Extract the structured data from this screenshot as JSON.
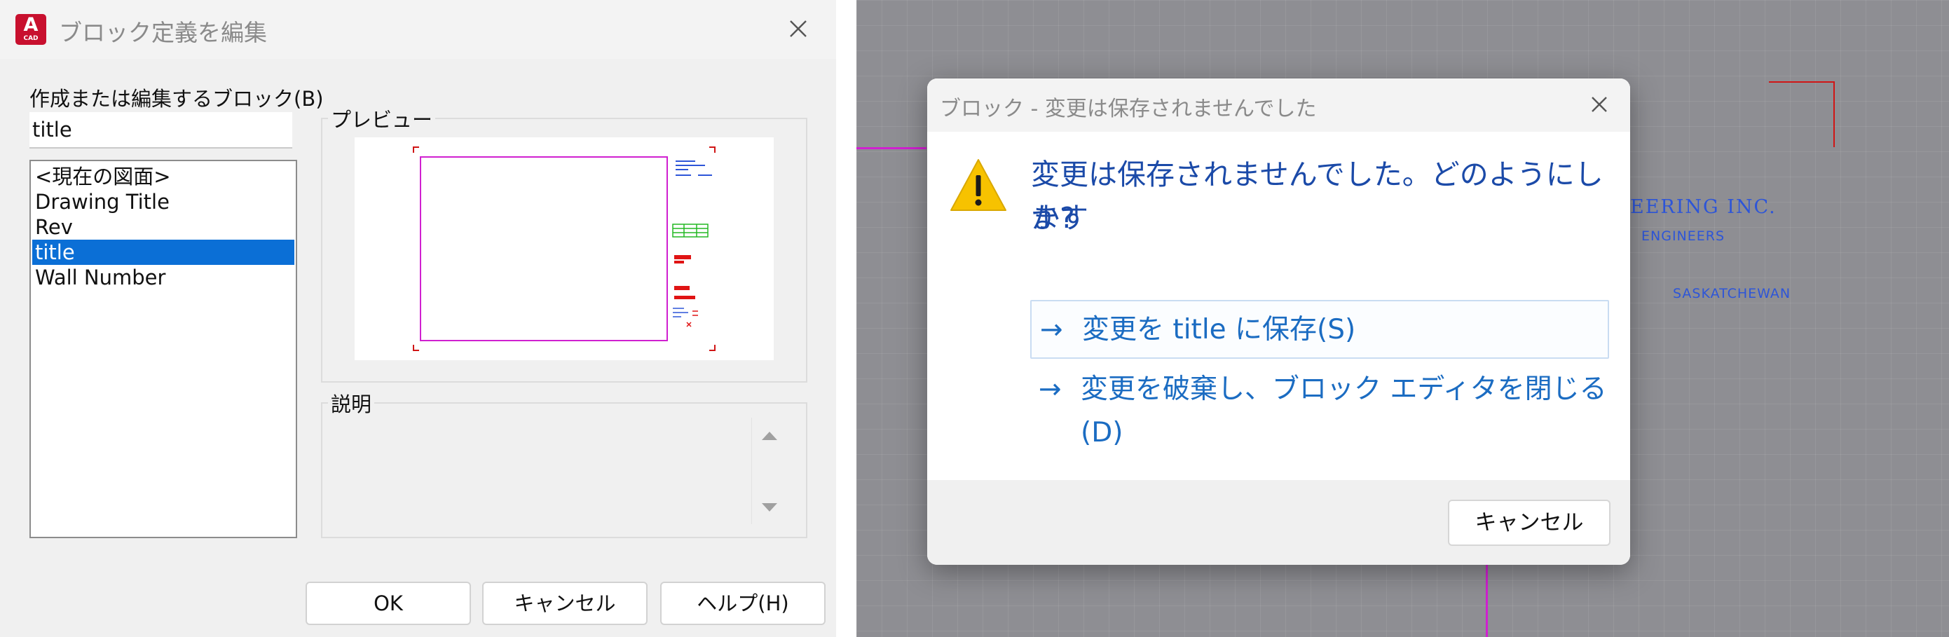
{
  "edit_dialog": {
    "app_icon": {
      "letter": "A",
      "sub": "CAD"
    },
    "title": "ブロック定義を編集",
    "block_label": "作成または編集するブロック(B)",
    "block_input_value": "title",
    "block_list": [
      {
        "label": "<現在の図面>",
        "selected": false
      },
      {
        "label": "Drawing Title",
        "selected": false
      },
      {
        "label": "Rev",
        "selected": false
      },
      {
        "label": "title",
        "selected": true
      },
      {
        "label": "Wall Number",
        "selected": false
      }
    ],
    "preview_label": "プレビュー",
    "description_label": "説明",
    "ok_label": "OK",
    "cancel_label": "キャンセル",
    "help_label": "ヘルプ(H)"
  },
  "unsaved_dialog": {
    "title": "ブロック - 変更は保存されませんでした",
    "heading_line1": "変更は保存されませんでした。どのようにします",
    "heading_line2": "か?",
    "option_save": "変更を title に保存(S)",
    "option_discard_line1": "変更を破棄し、ブロック エディタを閉じる",
    "option_discard_line2": "(D)",
    "cancel_label": "キャンセル"
  },
  "drawing_background": {
    "text_company": "EERING INC.",
    "text_engineers": "ENGINEERS",
    "text_location": "SASKATCHEWAN"
  },
  "colors": {
    "accent": "#0b6fd6",
    "heading": "#1b4aa8",
    "command_link": "#1b6cc2",
    "cad_red": "#c8102e",
    "cad_text_blue": "#2d55d8",
    "cad_magenta": "#d020d0"
  }
}
